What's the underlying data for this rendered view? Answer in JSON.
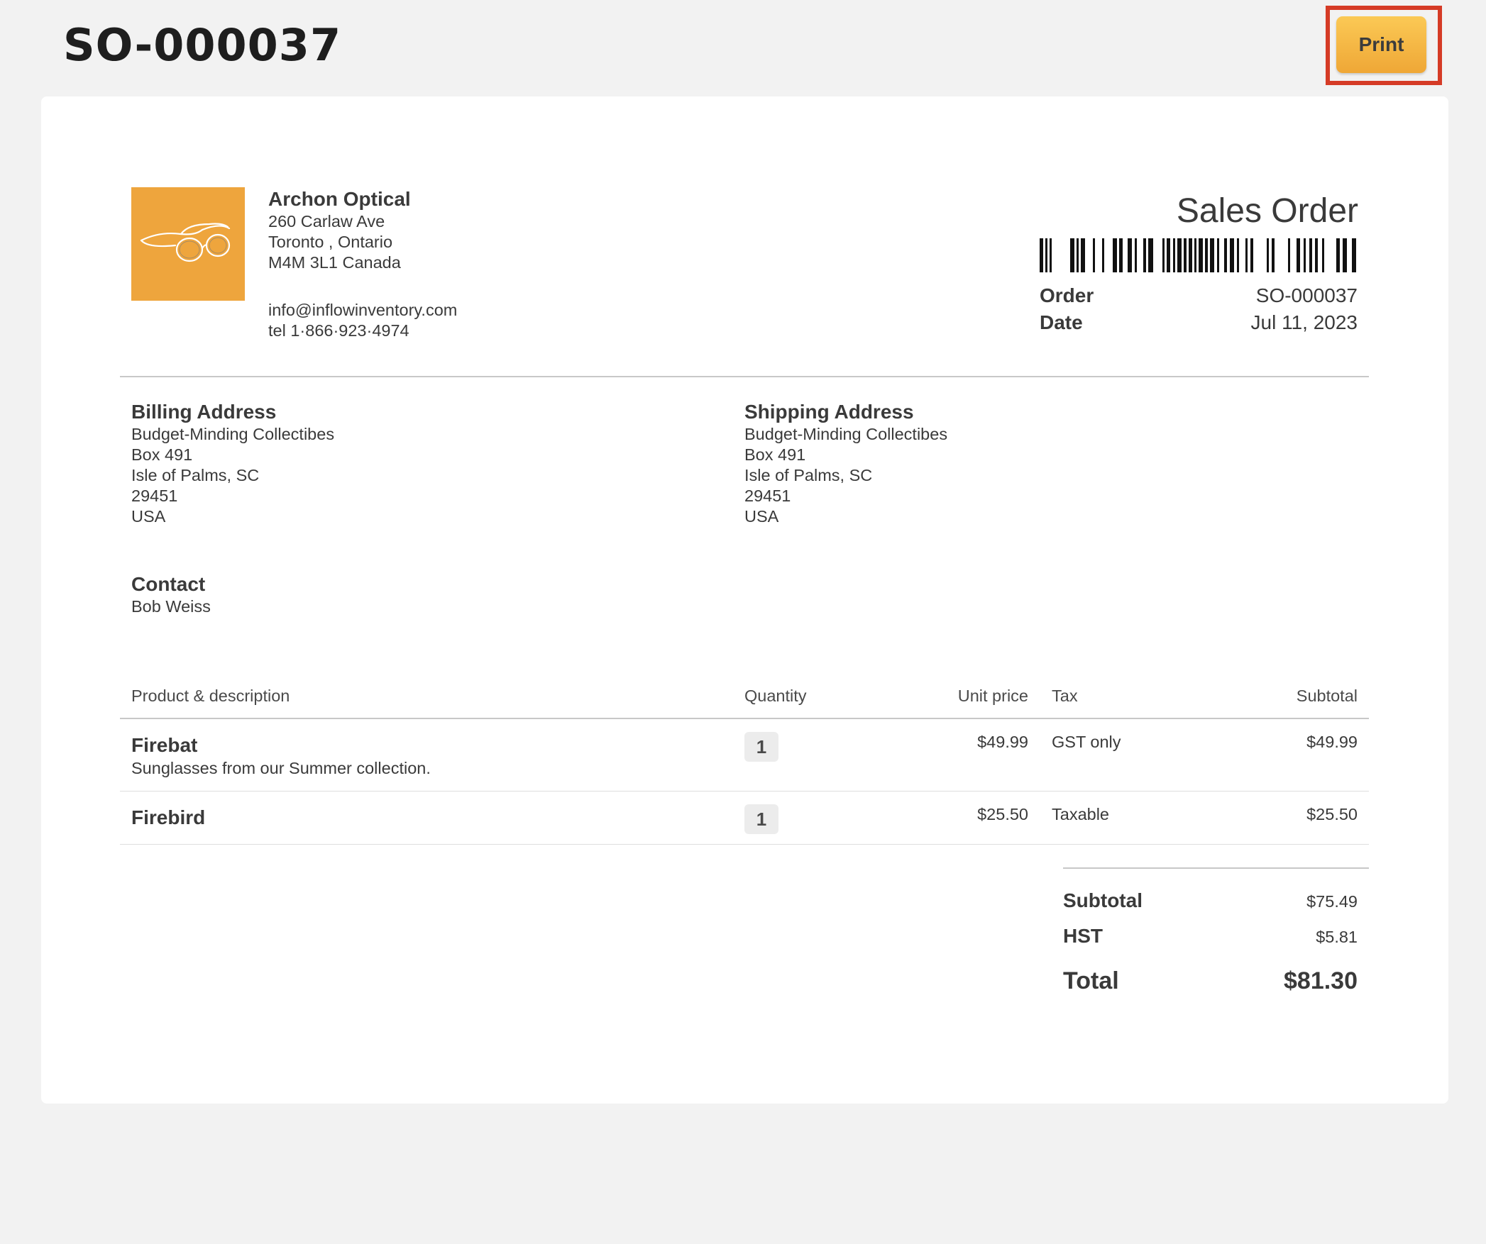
{
  "header": {
    "title": "SO-000037",
    "print_label": "Print"
  },
  "company": {
    "name": "Archon Optical",
    "address_lines": [
      "260 Carlaw Ave",
      "Toronto , Ontario",
      "M4M 3L1 Canada"
    ],
    "email": "info@inflowinventory.com",
    "phone": "tel 1·866·923·4974",
    "logo_color": "#eea53d"
  },
  "document": {
    "title": "Sales Order",
    "order_label": "Order",
    "order_value": "SO-000037",
    "date_label": "Date",
    "date_value": "Jul 11, 2023"
  },
  "billing": {
    "title": "Billing Address",
    "lines": [
      "Budget-Minding Collectibes",
      "Box 491",
      "Isle of Palms, SC",
      "29451",
      "USA"
    ]
  },
  "shipping": {
    "title": "Shipping Address",
    "lines": [
      "Budget-Minding Collectibes",
      "Box 491",
      "Isle of Palms, SC",
      "29451",
      "USA"
    ]
  },
  "contact": {
    "title": "Contact",
    "name": "Bob Weiss"
  },
  "table": {
    "headers": [
      "Product & description",
      "Quantity",
      "Unit price",
      "Tax",
      "Subtotal"
    ],
    "rows": [
      {
        "name": "Firebat",
        "description": "Sunglasses from our Summer collection.",
        "quantity": "1",
        "unit_price": "$49.99",
        "tax": "GST only",
        "subtotal": "$49.99"
      },
      {
        "name": "Firebird",
        "description": "",
        "quantity": "1",
        "unit_price": "$25.50",
        "tax": "Taxable",
        "subtotal": "$25.50"
      }
    ]
  },
  "totals": {
    "subtotal_label": "Subtotal",
    "subtotal_value": "$75.49",
    "tax_label": "HST",
    "tax_value": "$5.81",
    "total_label": "Total",
    "total_value": "$81.30"
  },
  "colors": {
    "accent": "#f4b544",
    "highlight": "#d53b26",
    "background": "#f2f2f2"
  }
}
